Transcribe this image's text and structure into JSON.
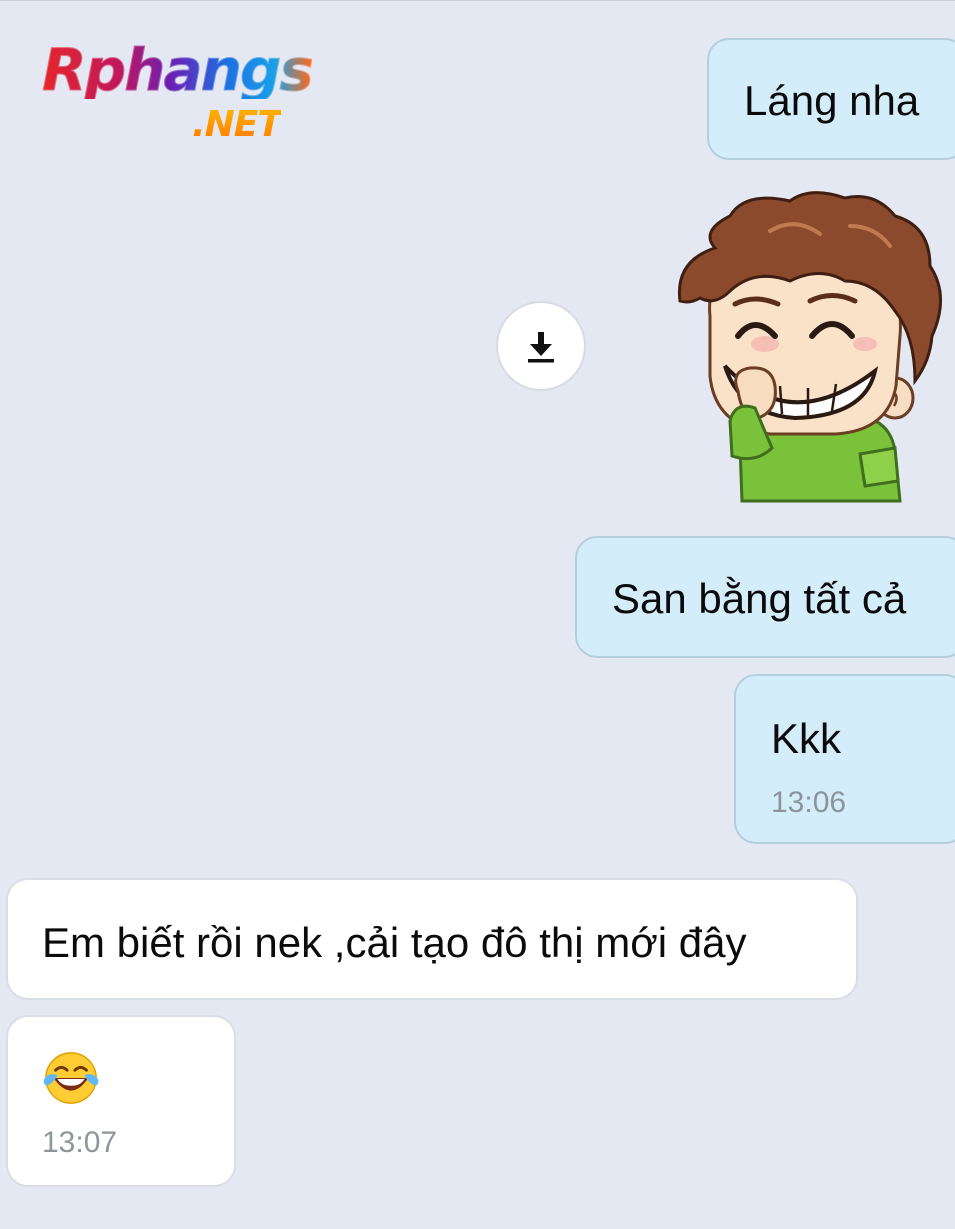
{
  "logo": {
    "main": "Rphangs",
    "suffix": ".NET"
  },
  "messages": {
    "m1": {
      "text": "Láng nha",
      "direction": "outgoing"
    },
    "sticker": {
      "name": "laughing-boy-sticker",
      "download_icon": "download-icon"
    },
    "m2": {
      "text": "San bằng tất cả",
      "direction": "outgoing"
    },
    "m3": {
      "text": "Kkk",
      "time": "13:06",
      "direction": "outgoing"
    },
    "m4": {
      "text": "Em biết rồi nek ,cải tạo đô thị mới đây",
      "direction": "incoming"
    },
    "m5": {
      "emoji": "face-with-tears-of-joy-emoji",
      "time": "13:07",
      "direction": "incoming"
    }
  },
  "colors": {
    "background": "#e3e8f3",
    "outgoing_bubble": "#d4edfa",
    "incoming_bubble": "#ffffff",
    "timestamp": "#8c949c"
  }
}
